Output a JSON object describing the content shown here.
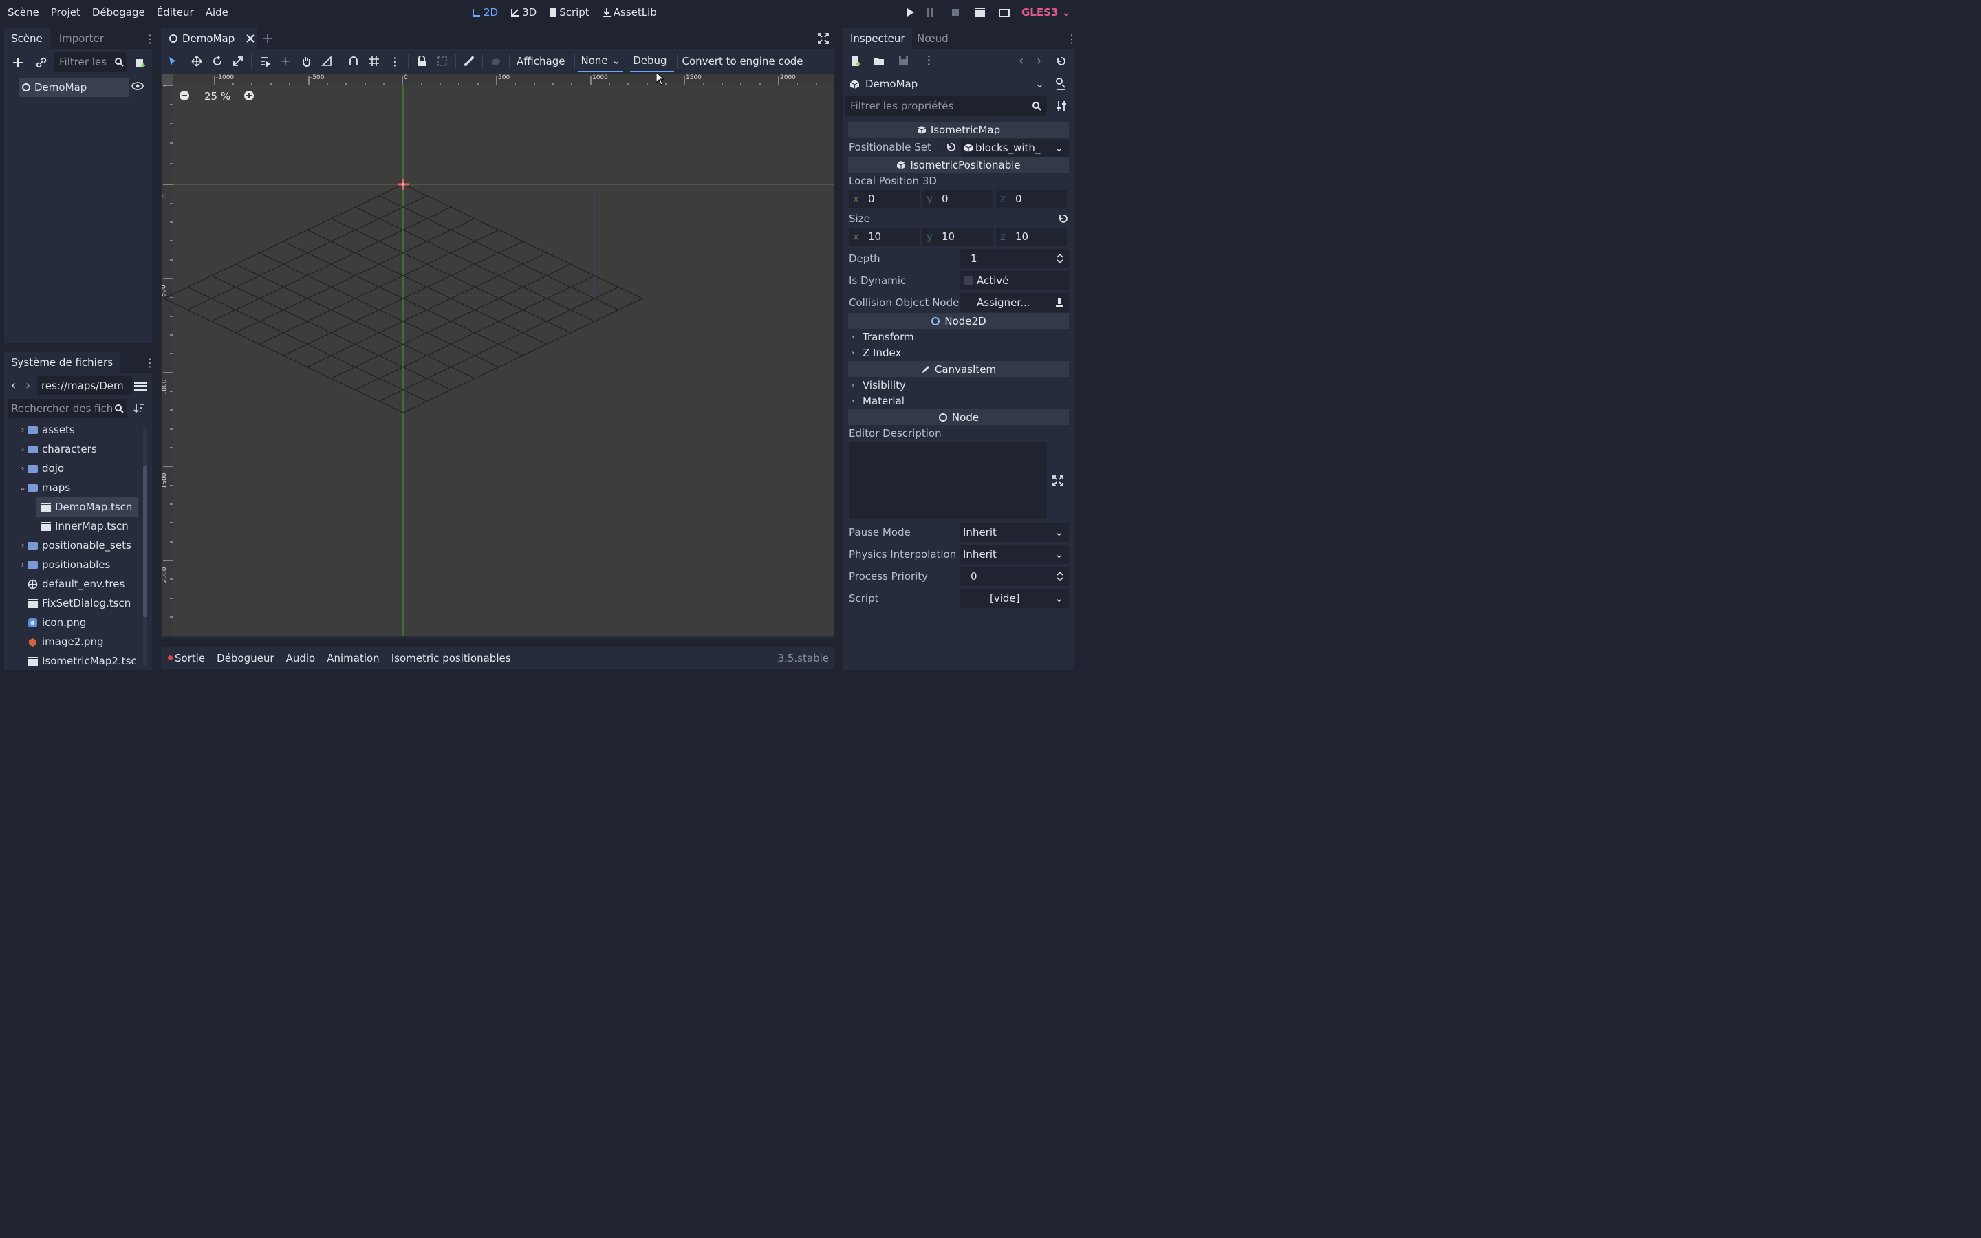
{
  "menu": [
    "Scène",
    "Projet",
    "Débogage",
    "Éditeur",
    "Aide"
  ],
  "modes": {
    "d2": "2D",
    "d3": "3D",
    "script": "Script",
    "assetlib": "AssetLib"
  },
  "renderer": "GLES3",
  "scene_dock": {
    "tabs": {
      "scene": "Scène",
      "import": "Importer"
    },
    "filter_placeholder": "Filtrer les",
    "root_node": "DemoMap"
  },
  "filesystem": {
    "title": "Système de fichiers",
    "path": "res://maps/Dem",
    "search_placeholder": "Rechercher des fichie",
    "items": [
      {
        "name": "assets",
        "kind": "folder"
      },
      {
        "name": "characters",
        "kind": "folder"
      },
      {
        "name": "dojo",
        "kind": "folder"
      },
      {
        "name": "maps",
        "kind": "folder-open"
      },
      {
        "name": "DemoMap.tscn",
        "kind": "scene"
      },
      {
        "name": "InnerMap.tscn",
        "kind": "scene"
      },
      {
        "name": "positionable_sets",
        "kind": "folder"
      },
      {
        "name": "positionables",
        "kind": "folder"
      },
      {
        "name": "default_env.tres",
        "kind": "globe"
      },
      {
        "name": "FixSetDialog.tscn",
        "kind": "scene"
      },
      {
        "name": "icon.png",
        "kind": "image"
      },
      {
        "name": "image2.png",
        "kind": "image"
      },
      {
        "name": "IsometricMap2.tsc",
        "kind": "scene"
      }
    ]
  },
  "editor": {
    "tab_title": "DemoMap",
    "toolbar": {
      "view": "Affichage",
      "none": "None",
      "debug": "Debug",
      "convert": "Convert to engine code"
    },
    "zoom": "25 %",
    "ruler_marks": [
      "-1000",
      "-500",
      "0",
      "500",
      "1000",
      "1500",
      "2000"
    ],
    "vruler_marks": [
      "-5",
      "0",
      "500",
      "1000",
      "1500",
      "2000"
    ]
  },
  "bottom": {
    "tabs": [
      "Sortie",
      "Débogueur",
      "Audio",
      "Animation",
      "Isometric positionables"
    ],
    "version": "3.5.stable"
  },
  "inspector": {
    "tabs": {
      "inspector": "Inspecteur",
      "node": "Nœud"
    },
    "object": "DemoMap",
    "filter_placeholder": "Filtrer les propriétés",
    "sections": {
      "isomap": "IsometricMap",
      "isopos": "IsometricPositionable",
      "node2d": "Node2D",
      "canvas": "CanvasItem",
      "node": "Node"
    },
    "positionable_set": {
      "label": "Positionable Set",
      "value": "blocks_with_"
    },
    "local_pos": {
      "label": "Local Position 3D",
      "x": "0",
      "y": "0",
      "z": "0"
    },
    "size": {
      "label": "Size",
      "x": "10",
      "y": "10",
      "z": "10"
    },
    "axes": {
      "x": "x",
      "y": "y",
      "z": "z"
    },
    "depth": {
      "label": "Depth",
      "value": "1"
    },
    "is_dynamic": {
      "label": "Is Dynamic",
      "value": "Activé"
    },
    "collision": {
      "label": "Collision Object Node",
      "value": "Assigner..."
    },
    "transform": "Transform",
    "zindex": "Z Index",
    "visibility": "Visibility",
    "material": "Material",
    "editor_desc": "Editor Description",
    "pause_mode": {
      "label": "Pause Mode",
      "value": "Inherit"
    },
    "physics_interp": {
      "label": "Physics Interpolation",
      "value": "Inherit"
    },
    "process_priority": {
      "label": "Process Priority",
      "value": "0"
    },
    "script": {
      "label": "Script",
      "value": "[vide]"
    }
  },
  "colors": {
    "accent": "#70a6ff",
    "gles": "#e05a8a",
    "axis_green": "#4aa02c"
  }
}
